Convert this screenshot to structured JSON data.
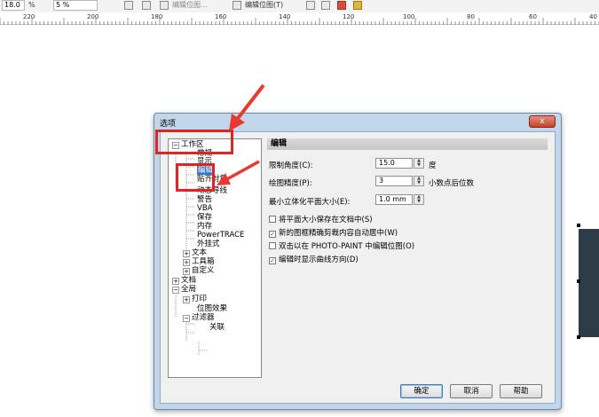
{
  "toolbar": {
    "zoom_value": "18.0",
    "zoom_unit": "%",
    "field2": "5 %",
    "item1": "编辑位图...",
    "item2": "编辑位图(T)"
  },
  "ruler": {
    "labels": [
      "220",
      "200",
      "180",
      "160",
      "140",
      "120",
      "100",
      "80",
      "60",
      "40"
    ]
  },
  "dialog": {
    "title": "选项",
    "close_label": "x",
    "tree": {
      "workspace": "工作区",
      "regular": "常规",
      "display": "显示",
      "edit": "编辑",
      "snap": "贴齐对象",
      "dynamic_guides": "动态导线",
      "warnings": "警告",
      "vba": "VBA",
      "save": "保存",
      "memory": "内存",
      "powertrace": "PowerTRACE",
      "plugins": "外挂式",
      "text": "文本",
      "toolbox": "工具箱",
      "customize": "自定义",
      "document": "文档",
      "global": "全局",
      "print": "打印",
      "bitmap_effects": "位图效果",
      "filters": "过滤器",
      "associations": "关联"
    },
    "panel": {
      "header": "编辑",
      "constrain_label": "限制角度(C):",
      "constrain_value": "15.0",
      "constrain_unit": "度",
      "drawing_precision_label": "绘图精度(P):",
      "drawing_precision_value": "3",
      "drawing_precision_unit": "小数点后位数",
      "min_extrude_label": "最小立体化平面大小(E):",
      "min_extrude_value": "1.0 mm",
      "check1": "将平面大小保存在文档中(S)",
      "check2": "新的图框精确剪裁内容自动居中(W)",
      "check3": "双击以在 PHOTO-PAINT 中编辑位图(O)",
      "check4": "编辑时显示曲线方向(D)"
    },
    "buttons": {
      "ok": "确定",
      "cancel": "取消",
      "help": "帮助"
    }
  },
  "colors": {
    "highlight": "#e02424",
    "arrow": "#e8382f",
    "dialog_frame": "#c2d6eb",
    "selection": "#3a78c8",
    "canvas_object": "#2e3c48"
  }
}
